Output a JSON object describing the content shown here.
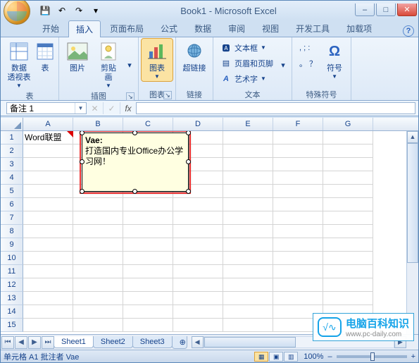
{
  "window": {
    "title": "Book1 - Microsoft Excel"
  },
  "qat": {
    "save": "💾",
    "undo": "↶",
    "redo": "↷",
    "more": "▾"
  },
  "winbuttons": {
    "min": "–",
    "max": "□",
    "close": "✕"
  },
  "tabs": {
    "items": [
      "开始",
      "插入",
      "页面布局",
      "公式",
      "数据",
      "审阅",
      "视图",
      "开发工具",
      "加载项"
    ],
    "active": "插入",
    "help": "?"
  },
  "ribbon": {
    "tables": {
      "pivot": "数据\n透视表",
      "table": "表",
      "label": "表"
    },
    "illus": {
      "picture": "图片",
      "clipart": "剪贴\n画",
      "more": "▾",
      "label": "插图"
    },
    "charts": {
      "chart": "图表",
      "label": "图表"
    },
    "links": {
      "hyperlink": "超链接",
      "label": "链接"
    },
    "text": {
      "textbox": "文本框",
      "headerfooter": "页眉和页脚",
      "wordart": "艺术字",
      "more": "▾",
      "label": "文本"
    },
    "symbols": {
      "dotsA": ", ; :",
      "dotsB": "。 ？",
      "symbol": "符号",
      "label": "特殊符号"
    }
  },
  "formula_bar": {
    "namebox": "备注 1",
    "fx": "fx"
  },
  "grid": {
    "columns": [
      "A",
      "B",
      "C",
      "D",
      "E",
      "F",
      "G"
    ],
    "rows": 15,
    "cells": {
      "A1": "Word联盟"
    }
  },
  "comment": {
    "author": "Vae:",
    "body": "打造国内专业Office办公学习网！"
  },
  "sheets": {
    "nav": [
      "⏮",
      "◀",
      "▶",
      "⏭"
    ],
    "tabs": [
      "Sheet1",
      "Sheet2",
      "Sheet3"
    ],
    "active": "Sheet1",
    "add": "⊕"
  },
  "status": {
    "text": "单元格 A1 批注者 Vae",
    "zoom": "100%",
    "minus": "–",
    "plus": "+"
  },
  "watermark": {
    "brand": "电脑百科知识",
    "url": "www.pc-daily.com",
    "glyph": "√∿"
  }
}
